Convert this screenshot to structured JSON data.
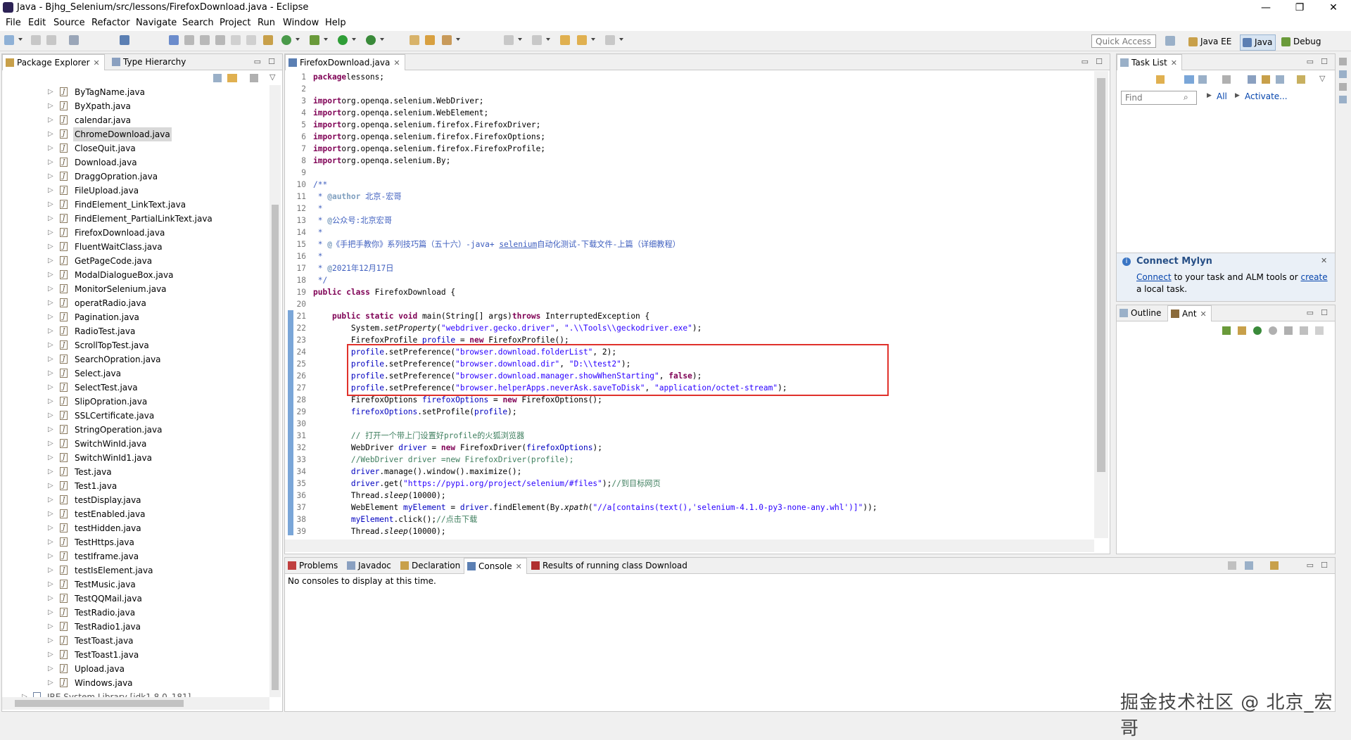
{
  "window": {
    "title": "Java - Bjhg_Selenium/src/lessons/FirefoxDownload.java - Eclipse",
    "minimize": "—",
    "restore": "❐",
    "close": "✕"
  },
  "menu": [
    "File",
    "Edit",
    "Source",
    "Refactor",
    "Navigate",
    "Search",
    "Project",
    "Run",
    "Window",
    "Help"
  ],
  "toolbar": {
    "quick_access_placeholder": "Quick Access",
    "perspectives": [
      "Java EE",
      "Java",
      "Debug"
    ]
  },
  "package_explorer": {
    "tabs": [
      "Package Explorer",
      "Type Hierarchy"
    ],
    "files": [
      "ByTagName.java",
      "ByXpath.java",
      "calendar.java",
      "ChromeDownload.java",
      "CloseQuit.java",
      "Download.java",
      "DraggOpration.java",
      "FileUpload.java",
      "FindElement_LinkText.java",
      "FindElement_PartialLinkText.java",
      "FirefoxDownload.java",
      "FluentWaitClass.java",
      "GetPageCode.java",
      "ModalDialogueBox.java",
      "MonitorSelenium.java",
      "operatRadio.java",
      "Pagination.java",
      "RadioTest.java",
      "ScrollTopTest.java",
      "SearchOpration.java",
      "Select.java",
      "SelectTest.java",
      "SlipOpration.java",
      "SSLCertificate.java",
      "StringOperation.java",
      "SwitchWinId.java",
      "SwitchWinId1.java",
      "Test.java",
      "Test1.java",
      "testDisplay.java",
      "testEnabled.java",
      "testHidden.java",
      "TestHttps.java",
      "testIframe.java",
      "testIsElement.java",
      "TestMusic.java",
      "TestQQMail.java",
      "TestRadio.java",
      "TestRadio1.java",
      "TestToast.java",
      "TestToast1.java",
      "Upload.java",
      "Windows.java"
    ],
    "selected": "ChromeDownload.java",
    "library_row": "JRE System Library [jdk1.8.0_181]"
  },
  "editor": {
    "tab": "FirefoxDownload.java",
    "line_numbers": [
      "1",
      "2",
      "3",
      "4",
      "5",
      "6",
      "7",
      "8",
      "9",
      "10",
      "11",
      "12",
      "13",
      "14",
      "15",
      "16",
      "17",
      "18",
      "19",
      "20",
      "21",
      "22",
      "23",
      "24",
      "25",
      "26",
      "27",
      "28",
      "29",
      "30",
      "31",
      "32",
      "33",
      "34",
      "35",
      "36",
      "37",
      "38",
      "39"
    ],
    "code": [
      [
        [
          "kw",
          "package"
        ],
        [
          "",
          "lessons;"
        ]
      ],
      [],
      [
        [
          "kw",
          "import"
        ],
        [
          "",
          "org.openqa.selenium.WebDriver;"
        ]
      ],
      [
        [
          "kw",
          "import"
        ],
        [
          "",
          "org.openqa.selenium.WebElement;"
        ]
      ],
      [
        [
          "kw",
          "import"
        ],
        [
          "",
          "org.openqa.selenium.firefox.FirefoxDriver;"
        ]
      ],
      [
        [
          "kw",
          "import"
        ],
        [
          "",
          "org.openqa.selenium.firefox.FirefoxOptions;"
        ]
      ],
      [
        [
          "kw",
          "import"
        ],
        [
          "",
          "org.openqa.selenium.firefox.FirefoxProfile;"
        ]
      ],
      [
        [
          "kw",
          "import"
        ],
        [
          "",
          "org.openqa.selenium.By;"
        ]
      ],
      [],
      [
        [
          "jd",
          "/**"
        ]
      ],
      [
        [
          "jd",
          " * "
        ],
        [
          "tag",
          "@author"
        ],
        [
          "jd",
          " 北京-宏哥"
        ]
      ],
      [
        [
          "jd",
          " *"
        ]
      ],
      [
        [
          "jd",
          " * "
        ],
        [
          "tag",
          "@"
        ],
        [
          "jd",
          "公众号:北京宏哥"
        ]
      ],
      [
        [
          "jd",
          " *"
        ]
      ],
      [
        [
          "jd",
          " * "
        ],
        [
          "tag",
          "@"
        ],
        [
          "jd",
          "《手把手教你》系列技巧篇（五十六）-java+ "
        ],
        [
          "jd ul",
          "selenium"
        ],
        [
          "jd",
          "自动化测试-下载文件-上篇（详细教程）"
        ]
      ],
      [
        [
          "jd",
          " *"
        ]
      ],
      [
        [
          "jd",
          " * "
        ],
        [
          "tag",
          "@"
        ],
        [
          "jd",
          "2021年12月17日"
        ]
      ],
      [
        [
          "jd",
          " */"
        ]
      ],
      [
        [
          "kw",
          "public class"
        ],
        [
          "",
          " FirefoxDownload {"
        ]
      ],
      [],
      [
        [
          "",
          "    "
        ],
        [
          "kw",
          "public static void"
        ],
        [
          "",
          " main(String[] args)"
        ],
        [
          "kw",
          "throws"
        ],
        [
          "",
          " InterruptedException {"
        ]
      ],
      [
        [
          "",
          "        System."
        ],
        [
          "it",
          "setProperty"
        ],
        [
          "",
          "("
        ],
        [
          "str",
          "\"webdriver.gecko.driver\""
        ],
        [
          "",
          ", "
        ],
        [
          "str",
          "\".\\\\Tools\\\\geckodriver.exe\""
        ],
        [
          "",
          ");"
        ]
      ],
      [
        [
          "",
          "        FirefoxProfile "
        ],
        [
          "fld",
          "profile"
        ],
        [
          "",
          " = "
        ],
        [
          "kw",
          "new"
        ],
        [
          "",
          " FirefoxProfile();"
        ]
      ],
      [
        [
          "",
          "        "
        ],
        [
          "fld",
          "profile"
        ],
        [
          "",
          ".setPreference("
        ],
        [
          "str",
          "\"browser.download.folderList\""
        ],
        [
          "",
          ", 2);"
        ]
      ],
      [
        [
          "",
          "        "
        ],
        [
          "fld",
          "profile"
        ],
        [
          "",
          ".setPreference("
        ],
        [
          "str",
          "\"browser.download.dir\""
        ],
        [
          "",
          ", "
        ],
        [
          "str",
          "\"D:\\\\test2\""
        ],
        [
          "",
          ");"
        ]
      ],
      [
        [
          "",
          "        "
        ],
        [
          "fld",
          "profile"
        ],
        [
          "",
          ".setPreference("
        ],
        [
          "str",
          "\"browser.download.manager.showWhenStarting\""
        ],
        [
          "",
          ", "
        ],
        [
          "kw",
          "false"
        ],
        [
          "",
          ");"
        ]
      ],
      [
        [
          "",
          "        "
        ],
        [
          "fld",
          "profile"
        ],
        [
          "",
          ".setPreference("
        ],
        [
          "str",
          "\"browser.helperApps.neverAsk.saveToDisk\""
        ],
        [
          "",
          ", "
        ],
        [
          "str",
          "\"application/octet-stream\""
        ],
        [
          "",
          ");"
        ]
      ],
      [
        [
          "",
          "        FirefoxOptions "
        ],
        [
          "fld",
          "firefoxOptions"
        ],
        [
          "",
          " = "
        ],
        [
          "kw",
          "new"
        ],
        [
          "",
          " FirefoxOptions();"
        ]
      ],
      [
        [
          "",
          "        "
        ],
        [
          "fld",
          "firefoxOptions"
        ],
        [
          "",
          ".setProfile("
        ],
        [
          "fld",
          "profile"
        ],
        [
          "",
          ");"
        ]
      ],
      [],
      [
        [
          "",
          "        "
        ],
        [
          "cm",
          "// 打开一个带上门设置好profile的火狐浏览器"
        ]
      ],
      [
        [
          "",
          "        WebDriver "
        ],
        [
          "fld",
          "driver"
        ],
        [
          "",
          " = "
        ],
        [
          "kw",
          "new"
        ],
        [
          "",
          " FirefoxDriver("
        ],
        [
          "fld",
          "firefoxOptions"
        ],
        [
          "",
          ");"
        ]
      ],
      [
        [
          "",
          "        "
        ],
        [
          "cm",
          "//WebDriver driver =new FirefoxDriver(profile);"
        ]
      ],
      [
        [
          "",
          "        "
        ],
        [
          "fld",
          "driver"
        ],
        [
          "",
          ".manage().window().maximize();"
        ]
      ],
      [
        [
          "",
          "        "
        ],
        [
          "fld",
          "driver"
        ],
        [
          "",
          ".get("
        ],
        [
          "str",
          "\"https://pypi.org/project/selenium/#files\""
        ],
        [
          "",
          ");"
        ],
        [
          "cm",
          "//到目标网页"
        ]
      ],
      [
        [
          "",
          "        Thread."
        ],
        [
          "it",
          "sleep"
        ],
        [
          "",
          "(10000);"
        ]
      ],
      [
        [
          "",
          "        WebElement "
        ],
        [
          "fld",
          "myElement"
        ],
        [
          "",
          " = "
        ],
        [
          "fld",
          "driver"
        ],
        [
          "",
          ".findElement(By."
        ],
        [
          "it",
          "xpath"
        ],
        [
          "",
          "("
        ],
        [
          "str",
          "\"//a[contains(text(),'selenium-4.1.0-py3-none-any.whl')]\""
        ],
        [
          "",
          "));"
        ]
      ],
      [
        [
          "",
          "        "
        ],
        [
          "fld",
          "myElement"
        ],
        [
          "",
          ".click();"
        ],
        [
          "cm",
          "//点击下载"
        ]
      ],
      [
        [
          "",
          "        Thread."
        ],
        [
          "it",
          "sleep"
        ],
        [
          "",
          "(10000);"
        ]
      ]
    ]
  },
  "task_list": {
    "tab": "Task List",
    "find_placeholder": "Find",
    "filter_all": "All",
    "activate": "Activate..."
  },
  "mylyn": {
    "title": "Connect Mylyn",
    "connect": "Connect",
    "text_mid": " to your task and ALM tools or ",
    "create": "create",
    "text_end": "a local task."
  },
  "outline": {
    "tabs": [
      "Outline",
      "Ant"
    ]
  },
  "bottom": {
    "tabs": [
      "Problems",
      "Javadoc",
      "Declaration",
      "Console",
      "Results of running class Download"
    ],
    "console_message": "No consoles to display at this time."
  },
  "watermark": "掘金技术社区 @ 北京_宏哥",
  "colors": {
    "highlight_box": "#e0312b",
    "keyword": "#7f0055",
    "string": "#2a00ff",
    "comment": "#3f7f5f"
  }
}
